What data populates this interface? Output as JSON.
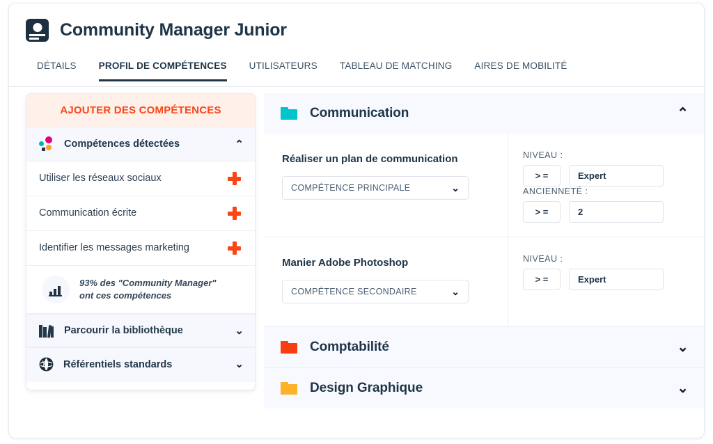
{
  "header": {
    "icon": "id-card-icon",
    "title": "Community Manager Junior"
  },
  "tabs": [
    {
      "label": "DÉTAILS",
      "active": false
    },
    {
      "label": "PROFIL DE COMPÉTENCES",
      "active": true
    },
    {
      "label": "UTILISATEURS",
      "active": false
    },
    {
      "label": "TABLEAU DE MATCHING",
      "active": false
    },
    {
      "label": "AIRES DE MOBILITÉ",
      "active": false
    }
  ],
  "sidebar": {
    "add_skills_label": "AJOUTER DES COMPÉTENCES",
    "detected": {
      "icon": "dots-cluster-icon",
      "label": "Compétences détectées",
      "chevron": "⌃",
      "expanded": true,
      "items": [
        {
          "label": "Utiliser les réseaux sociaux",
          "action_icon": "plus-icon"
        },
        {
          "label": "Communication écrite",
          "action_icon": "plus-icon"
        },
        {
          "label": "Identifier les messages marketing",
          "action_icon": "plus-icon"
        }
      ],
      "stat": {
        "icon": "bar-chart-icon",
        "line1": "93% des \"Community Manager\"",
        "line2": "ont ces compétences",
        "percent": "93%"
      }
    },
    "library": {
      "icon": "books-icon",
      "label": "Parcourir la bibliothèque",
      "chevron": "⌄",
      "expanded": false
    },
    "standards": {
      "icon": "globe-icon",
      "label": "Référentiels standards",
      "chevron": "⌄",
      "expanded": false
    }
  },
  "categories": [
    {
      "name": "Communication",
      "color": "#00c4cc",
      "expanded": true,
      "chevron": "⌃",
      "skills": [
        {
          "name": "Réaliser un plan de communication",
          "type_value": "COMPÉTENCE PRINCIPALE",
          "type_chevron": "⌄",
          "fields": [
            {
              "label": "NIVEAU :",
              "operator": "> =",
              "value": "Expert"
            },
            {
              "label": "ANCIENNETÉ :",
              "operator": "> =",
              "value": "2"
            }
          ]
        },
        {
          "name": "Manier Adobe Photoshop",
          "type_value": "COMPÉTENCE SECONDAIRE",
          "type_chevron": "⌄",
          "fields": [
            {
              "label": "NIVEAU :",
              "operator": "> =",
              "value": "Expert"
            }
          ]
        }
      ]
    },
    {
      "name": "Comptabilité",
      "color": "#fa3c12",
      "expanded": false,
      "chevron": "⌄",
      "skills": []
    },
    {
      "name": "Design Graphique",
      "color": "#fcb22a",
      "expanded": false,
      "chevron": "⌄",
      "skills": []
    }
  ],
  "colors": {
    "accent_orange": "#fa4616",
    "dark_navy": "#1e3447",
    "panel_bg": "#f7f9fe",
    "peach_bg": "#fff0ea"
  }
}
